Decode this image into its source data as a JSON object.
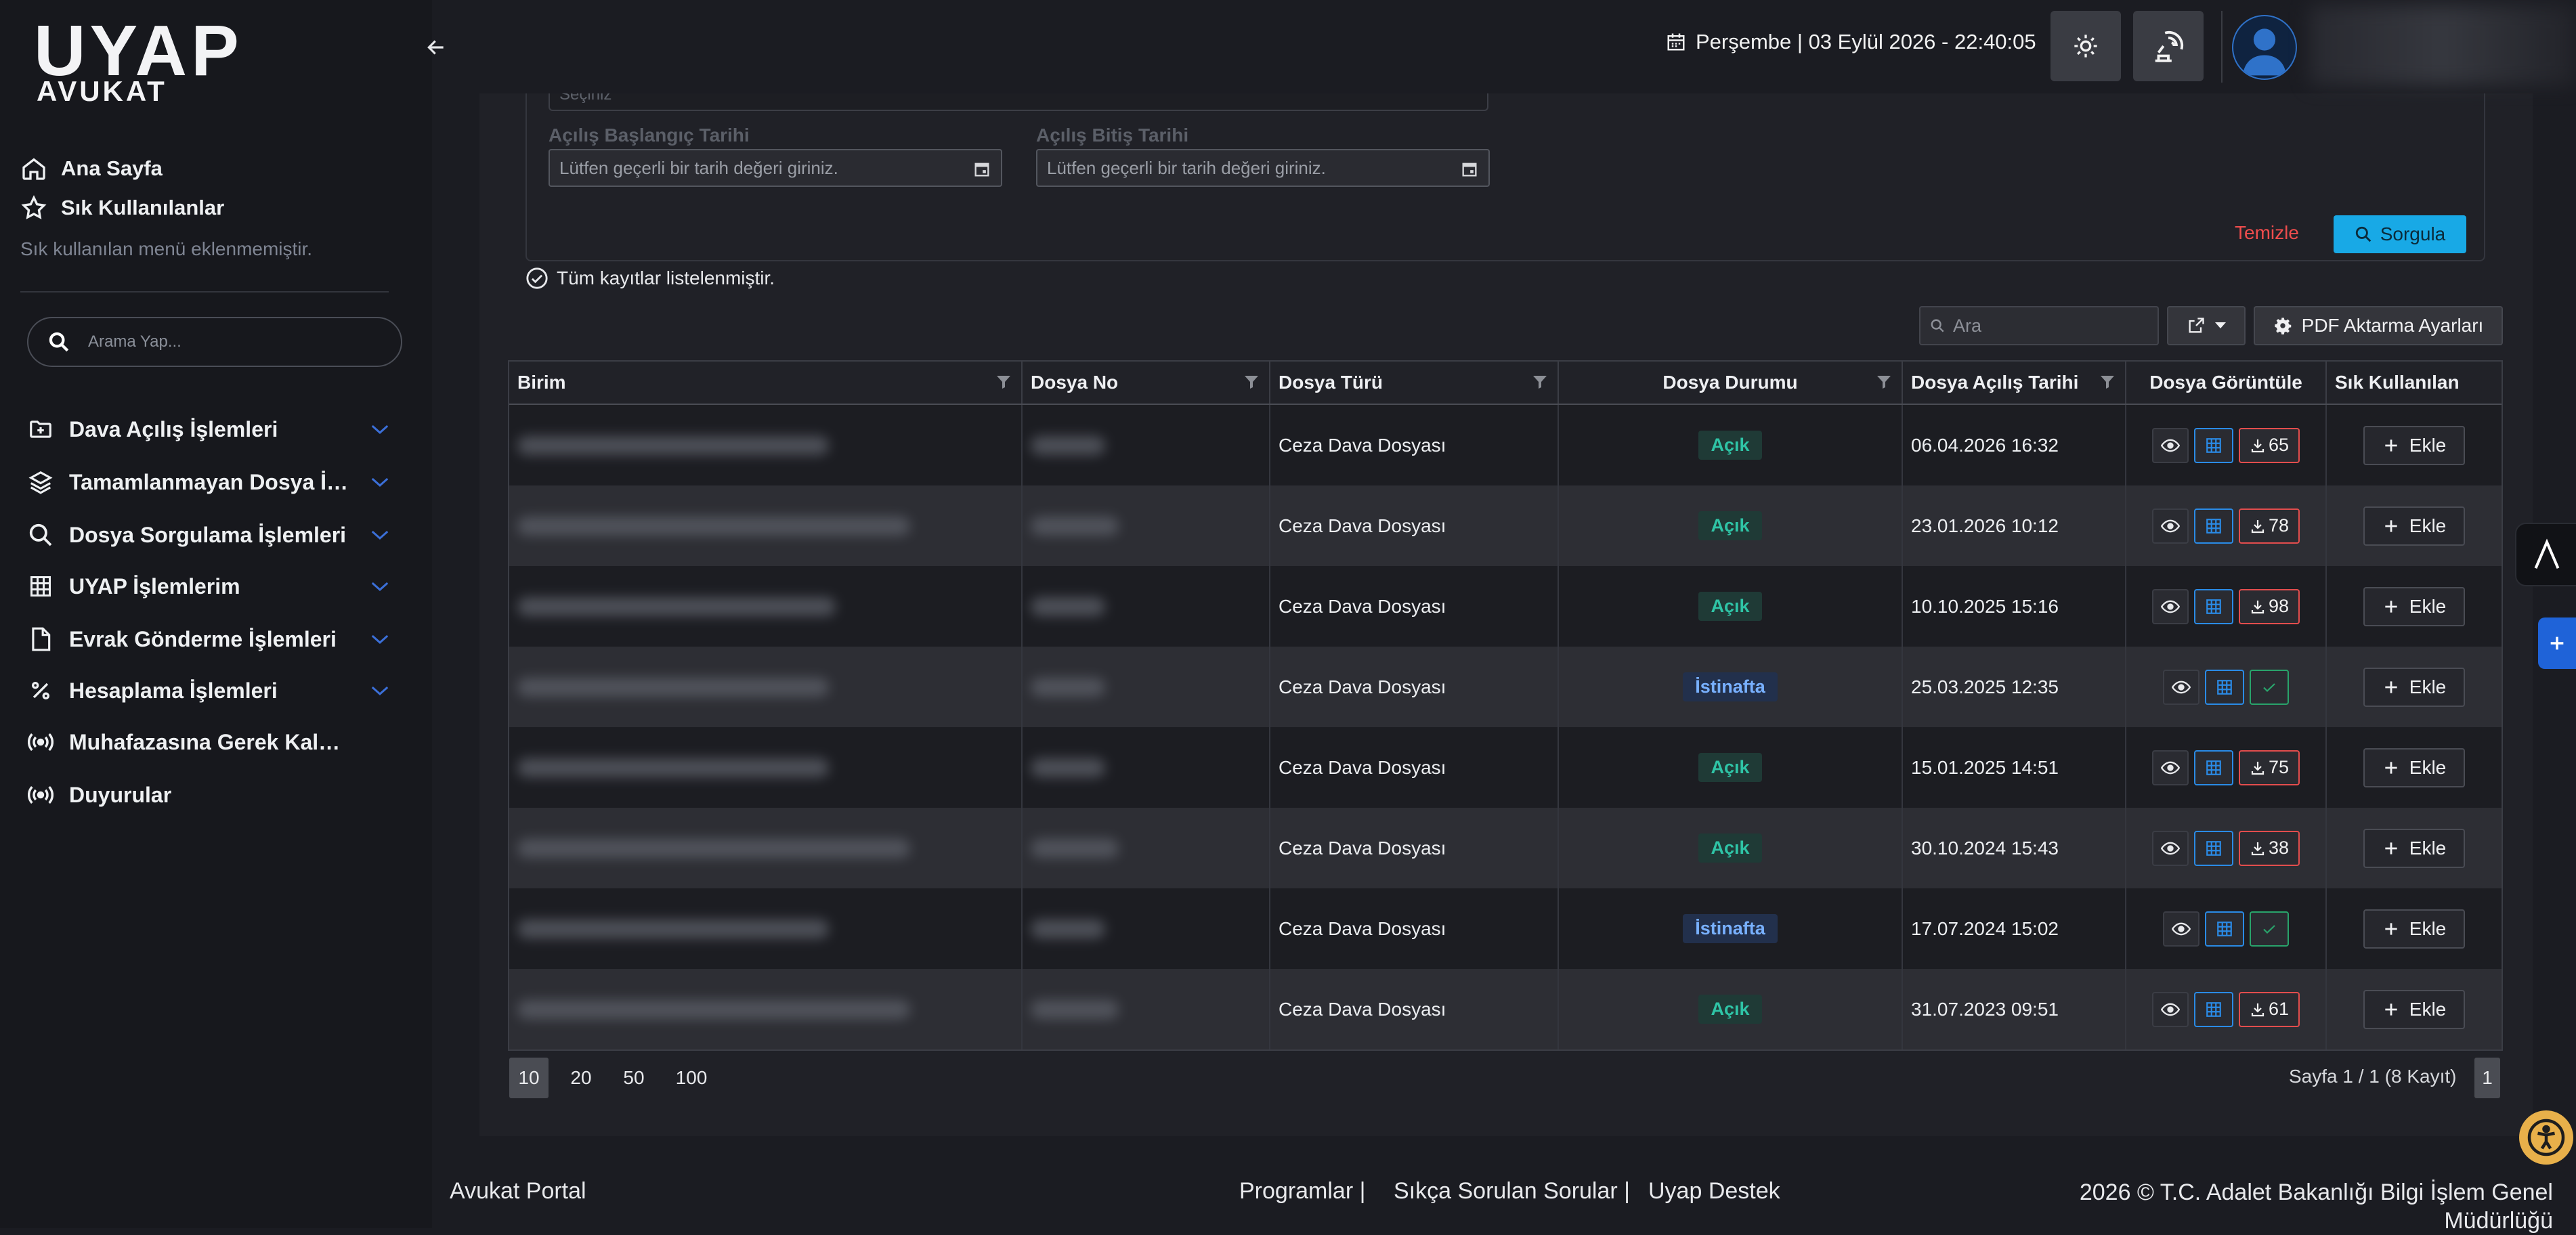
{
  "brand": {
    "name": "UYAP",
    "subtitle": "AVUKAT"
  },
  "sidebar": {
    "home": "Ana Sayfa",
    "favorites": "Sık Kullanılanlar",
    "favorites_hint": "Sık kullanılan menü eklenmemiştir.",
    "search_placeholder": "Arama Yap...",
    "menu": [
      {
        "label": "Dava Açılış İşlemleri",
        "icon": "file-plus-icon"
      },
      {
        "label": "Tamamlanmayan Dosya İşlemleri",
        "icon": "layers-icon"
      },
      {
        "label": "Dosya Sorgulama İşlemleri",
        "icon": "search-icon"
      },
      {
        "label": "UYAP İşlemlerim",
        "icon": "grid-icon"
      },
      {
        "label": "Evrak Gönderme İşlemleri",
        "icon": "document-icon"
      },
      {
        "label": "Hesaplama İşlemleri",
        "icon": "percent-icon"
      },
      {
        "label": "Muhafazasına Gerek Kalmayan",
        "icon": "broadcast-icon"
      },
      {
        "label": "Duyurular",
        "icon": "broadcast-icon"
      }
    ]
  },
  "header": {
    "datetime": "Perşembe | 03 Eylül 2026 - 22:40:05"
  },
  "filters": {
    "select_placeholder": "Seçiniz",
    "start_label": "Açılış Başlangıç Tarihi",
    "end_label": "Açılış Bitiş Tarihi",
    "date_placeholder": "Lütfen geçerli bir tarih değeri giriniz.",
    "clear": "Temizle",
    "query": "Sorgula"
  },
  "status_message": "Tüm kayıtlar listelenmiştir.",
  "toolbar": {
    "search_placeholder": "Ara",
    "pdf_settings": "PDF Aktarma Ayarları"
  },
  "table": {
    "columns": [
      "Birim",
      "Dosya No",
      "Dosya Türü",
      "Dosya Durumu",
      "Dosya Açılış Tarihi",
      "Dosya Görüntüle",
      "Sık Kullanılan"
    ],
    "add_label": "Ekle",
    "rows": [
      {
        "type": "Ceza Dava Dosyası",
        "status": "Açık",
        "status_kind": "acik",
        "date": "06.04.2026 16:32",
        "docs": "65"
      },
      {
        "type": "Ceza Dava Dosyası",
        "status": "Açık",
        "status_kind": "acik",
        "date": "23.01.2026 10:12",
        "docs": "78"
      },
      {
        "type": "Ceza Dava Dosyası",
        "status": "Açık",
        "status_kind": "acik",
        "date": "10.10.2025 15:16",
        "docs": "98"
      },
      {
        "type": "Ceza Dava Dosyası",
        "status": "İstinafta",
        "status_kind": "ist",
        "date": "25.03.2025 12:35",
        "docs": null
      },
      {
        "type": "Ceza Dava Dosyası",
        "status": "Açık",
        "status_kind": "acik",
        "date": "15.01.2025 14:51",
        "docs": "75"
      },
      {
        "type": "Ceza Dava Dosyası",
        "status": "Açık",
        "status_kind": "acik",
        "date": "30.10.2024 15:43",
        "docs": "38"
      },
      {
        "type": "Ceza Dava Dosyası",
        "status": "İstinafta",
        "status_kind": "ist",
        "date": "17.07.2024 15:02",
        "docs": null
      },
      {
        "type": "Ceza Dava Dosyası",
        "status": "Açık",
        "status_kind": "acik",
        "date": "31.07.2023 09:51",
        "docs": "61"
      }
    ]
  },
  "pagination": {
    "sizes": [
      "10",
      "20",
      "50",
      "100"
    ],
    "active_size": "10",
    "info": "Sayfa 1 / 1 (8 Kayıt)",
    "page": "1"
  },
  "footer": {
    "portal": "Avukat Portal",
    "links": [
      "Programlar |",
      "Sıkça Sorulan Sorular |",
      "Uyap Destek"
    ],
    "copyright": "2026 © T.C. Adalet Bakanlığı Bilgi İşlem Genel Müdürlüğü"
  },
  "colors": {
    "accent": "#18a9e6",
    "danger": "#ef4d4d",
    "open": "#2fc4a6",
    "appeal": "#78b0ff"
  }
}
